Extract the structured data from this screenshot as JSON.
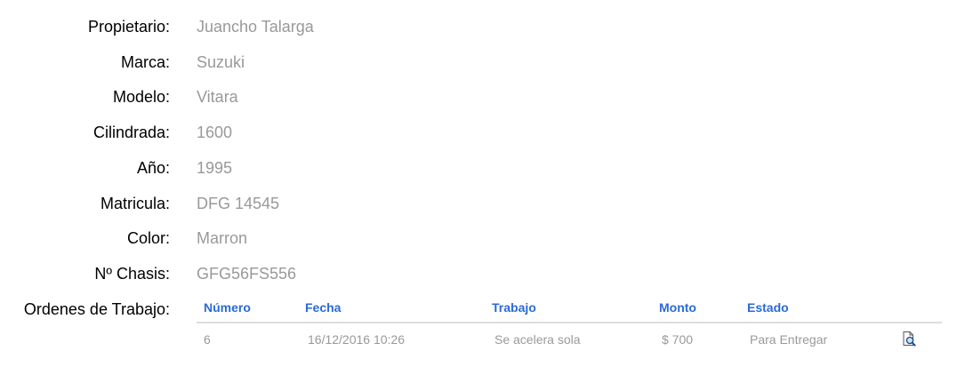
{
  "vehicle": {
    "fields": [
      {
        "label": "Propietario:",
        "value": "Juancho Talarga"
      },
      {
        "label": "Marca:",
        "value": "Suzuki"
      },
      {
        "label": "Modelo:",
        "value": "Vitara"
      },
      {
        "label": "Cilindrada:",
        "value": "1600"
      },
      {
        "label": "Año:",
        "value": "1995"
      },
      {
        "label": "Matricula:",
        "value": "DFG 14545"
      },
      {
        "label": "Color:",
        "value": "Marron"
      },
      {
        "label": "Nº Chasis:",
        "value": "GFG56FS556"
      }
    ]
  },
  "orders": {
    "label": "Ordenes de Trabajo:",
    "columns": [
      "Número",
      "Fecha",
      "Trabajo",
      "Monto",
      "Estado"
    ],
    "rows": [
      {
        "numero": "6",
        "fecha": "16/12/2016 10:26",
        "trabajo": "Se acelera sola",
        "monto": "$ 700",
        "estado": "Para Entregar",
        "action_icon": "view-details-icon"
      }
    ]
  },
  "colors": {
    "header_blue": "#2a6ad8",
    "value_gray": "#999999",
    "label_black": "#000000",
    "divider": "#dddddd"
  }
}
